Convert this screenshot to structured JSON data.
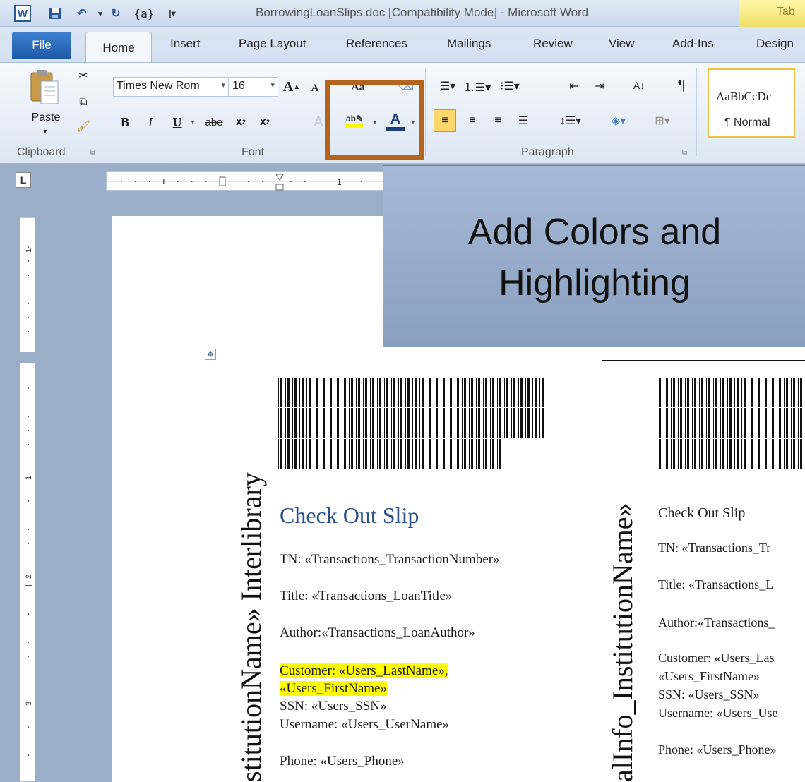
{
  "window": {
    "title": "BorrowingLoanSlips.doc [Compatibility Mode]  -  Microsoft Word",
    "context_tab": "Tab"
  },
  "qat": {
    "word_logo": "W",
    "field": "{a}"
  },
  "tabs": [
    "File",
    "Home",
    "Insert",
    "Page Layout",
    "References",
    "Mailings",
    "Review",
    "View",
    "Add-Ins",
    "Design"
  ],
  "ribbon": {
    "paste_label": "Paste",
    "groups": [
      "Clipboard",
      "Font",
      "Paragraph"
    ],
    "font_name": "Times New Rom",
    "font_size": "16",
    "style_preview": "AaBbCcDc",
    "style_name": "¶ Normal"
  },
  "overlay": {
    "line1": "Add Colors and",
    "line2": "Highlighting"
  },
  "slip1": {
    "vertical_text": "stitutionName» Interlibrary",
    "heading": "Check Out Slip",
    "tn": "TN: «Transactions_TransactionNumber»",
    "title": "Title: «Transactions_LoanTitle»",
    "author": "Author:«Transactions_LoanAuthor»",
    "customer_line1": "Customer: «Users_LastName»,",
    "customer_line2": "«Users_FirstName»",
    "ssn": "SSN:  «Users_SSN»",
    "username": "Username: «Users_UserName»",
    "phone": "Phone: «Users_Phone»"
  },
  "slip2": {
    "vertical_text": "alInfo_InstitutionName»",
    "heading": "Check Out Slip",
    "tn": "TN: «Transactions_Tr",
    "title": "Title: «Transactions_L",
    "author": "Author:«Transactions_",
    "customer_line1": "Customer: «Users_Las",
    "customer_line2": "«Users_FirstName»",
    "ssn": "SSN:  «Users_SSN»",
    "username": "Username: «Users_Use",
    "phone": "Phone: «Users_Phone»"
  },
  "colors": {
    "highlight": "#ffff00",
    "callout_border": "#b5641b",
    "heading_blue": "#2a4f8a",
    "overlay_bg": "#8fa6c6"
  }
}
